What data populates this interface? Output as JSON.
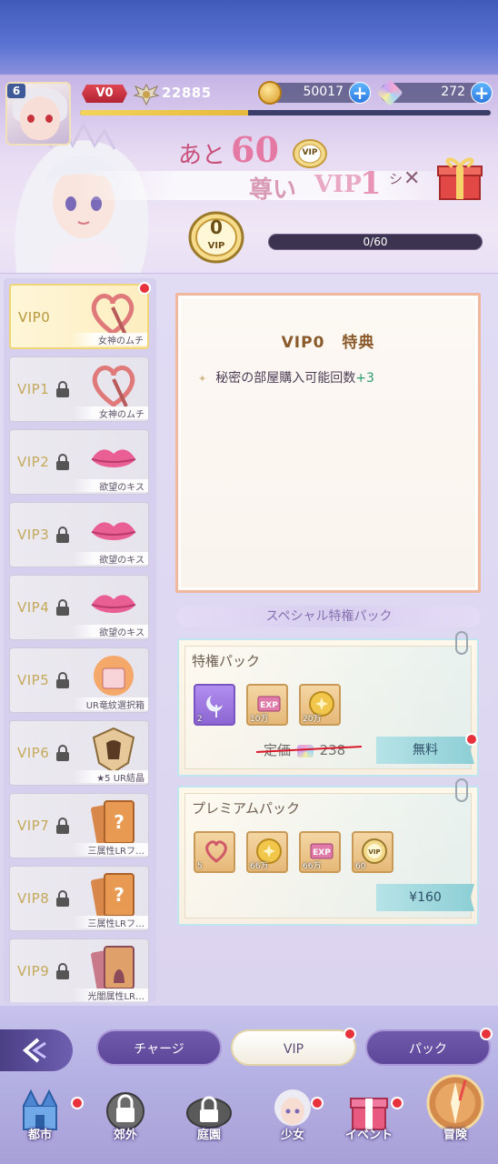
{
  "header": {
    "player_level": "6",
    "vip_badge": "V0",
    "power": "22885",
    "gold": "50017",
    "gems": "272",
    "exp_progress": 0.41
  },
  "banner": {
    "remaining_prefix": "あと",
    "remaining_points": "60",
    "medal_label": "VIP",
    "line_prefix": "尊い",
    "target_vip": "VIP",
    "target_level": "1",
    "suffix": "シ"
  },
  "vip_status": {
    "level": "0",
    "medal_label": "VIP",
    "progress_text": "0/60",
    "progress_fraction": 0
  },
  "vip_list": [
    {
      "label": "VIP0",
      "caption": "女神のムチ",
      "selected": true,
      "locked": false,
      "dot": true
    },
    {
      "label": "VIP1",
      "caption": "女神のムチ",
      "selected": false,
      "locked": true,
      "dot": false
    },
    {
      "label": "VIP2",
      "caption": "欲望のキス",
      "selected": false,
      "locked": true,
      "dot": false
    },
    {
      "label": "VIP3",
      "caption": "欲望のキス",
      "selected": false,
      "locked": true,
      "dot": false
    },
    {
      "label": "VIP4",
      "caption": "欲望のキス",
      "selected": false,
      "locked": true,
      "dot": false
    },
    {
      "label": "VIP5",
      "caption": "UR竜紋選択箱",
      "selected": false,
      "locked": true,
      "dot": false
    },
    {
      "label": "VIP6",
      "caption": "★5 UR結晶",
      "selected": false,
      "locked": true,
      "dot": false
    },
    {
      "label": "VIP7",
      "caption": "三属性LRフ…",
      "selected": false,
      "locked": true,
      "dot": false
    },
    {
      "label": "VIP8",
      "caption": "三属性LRフ…",
      "selected": false,
      "locked": true,
      "dot": false
    },
    {
      "label": "VIP9",
      "caption": "光闇属性LR…",
      "selected": false,
      "locked": true,
      "dot": false
    }
  ],
  "benefit": {
    "title_vip": "VIP0",
    "title_word": "特典",
    "line_text": "秘密の部屋購入可能回数",
    "line_value": "+3"
  },
  "special": {
    "header": "スペシャル特権パック",
    "privilege_pack": {
      "title": "特権パック",
      "items": [
        {
          "icon": "moon-wand-icon",
          "count": "2"
        },
        {
          "icon": "exp-card-icon",
          "count": "10万"
        },
        {
          "icon": "gold-coin-icon",
          "count": "20万"
        }
      ],
      "old_price_label": "定価",
      "old_price": "238",
      "button": "無料"
    },
    "premium_pack": {
      "title": "プレミアムパック",
      "items": [
        {
          "icon": "heart-wand-icon",
          "count": "5"
        },
        {
          "icon": "gold-coin-icon",
          "count": "66万"
        },
        {
          "icon": "exp-card-icon",
          "count": "66万"
        },
        {
          "icon": "vip-medal-icon",
          "count": "60"
        }
      ],
      "button": "¥160"
    }
  },
  "tabs": {
    "charge": "チャージ",
    "vip": "VIP",
    "pack": "パック"
  },
  "nav": [
    {
      "id": "city",
      "label": "都市",
      "icon": "castle-icon",
      "dot": true
    },
    {
      "id": "suburb",
      "label": "郊外",
      "icon": "locked-helmet-icon",
      "dot": false
    },
    {
      "id": "garden",
      "label": "庭園",
      "icon": "locked-garden-icon",
      "dot": false
    },
    {
      "id": "girl",
      "label": "少女",
      "icon": "girl-portrait-icon",
      "dot": true
    },
    {
      "id": "event",
      "label": "イベント",
      "icon": "gift-box-icon",
      "dot": true
    },
    {
      "id": "adventure",
      "label": "冒険",
      "icon": "compass-icon",
      "dot": false
    }
  ],
  "colors": {
    "accent_red": "#e8323b",
    "vip_gold": "#c4a95b",
    "title_brown": "#8a5a2b",
    "bonus_green": "#2e9b6a"
  }
}
